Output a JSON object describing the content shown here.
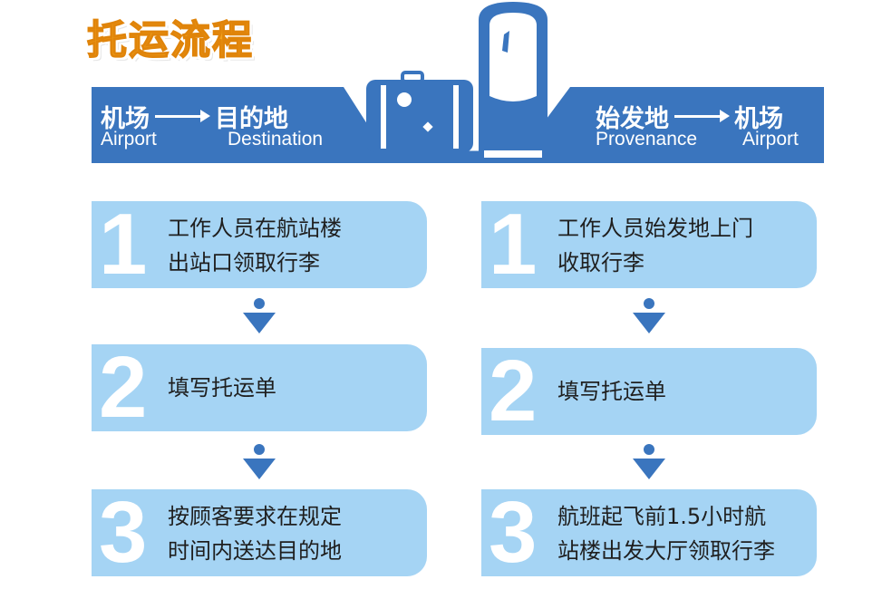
{
  "title": "托运流程",
  "banner": {
    "left": {
      "from_cn": "机场",
      "to_cn": "目的地",
      "from_en": "Airport",
      "to_en": "Destination"
    },
    "right": {
      "from_cn": "始发地",
      "to_cn": "机场",
      "from_en": "Provenance",
      "to_en": "Airport"
    }
  },
  "left_column": {
    "steps": [
      {
        "num": "1",
        "line1": "工作人员在航站楼",
        "line2": "出站口领取行李"
      },
      {
        "num": "2",
        "line1": "填写托运单",
        "line2": ""
      },
      {
        "num": "3",
        "line1": "按顾客要求在规定",
        "line2": "时间内送达目的地"
      }
    ]
  },
  "right_column": {
    "steps": [
      {
        "num": "1",
        "line1": "工作人员始发地上门",
        "line2": "收取行李"
      },
      {
        "num": "2",
        "line1": "填写托运单",
        "line2": ""
      },
      {
        "num": "3",
        "line1": "航班起飞前1.5小时航",
        "line2": "站楼出发大厅领取行李"
      }
    ]
  },
  "colors": {
    "banner": "#3a75be",
    "step_box": "#a5d4f4",
    "title": "#f2a21b",
    "connector": "#3a75be"
  },
  "icons": [
    "suitcase-icon",
    "luggage-tag-icon",
    "arrow-right-icon",
    "down-arrow-icon"
  ]
}
